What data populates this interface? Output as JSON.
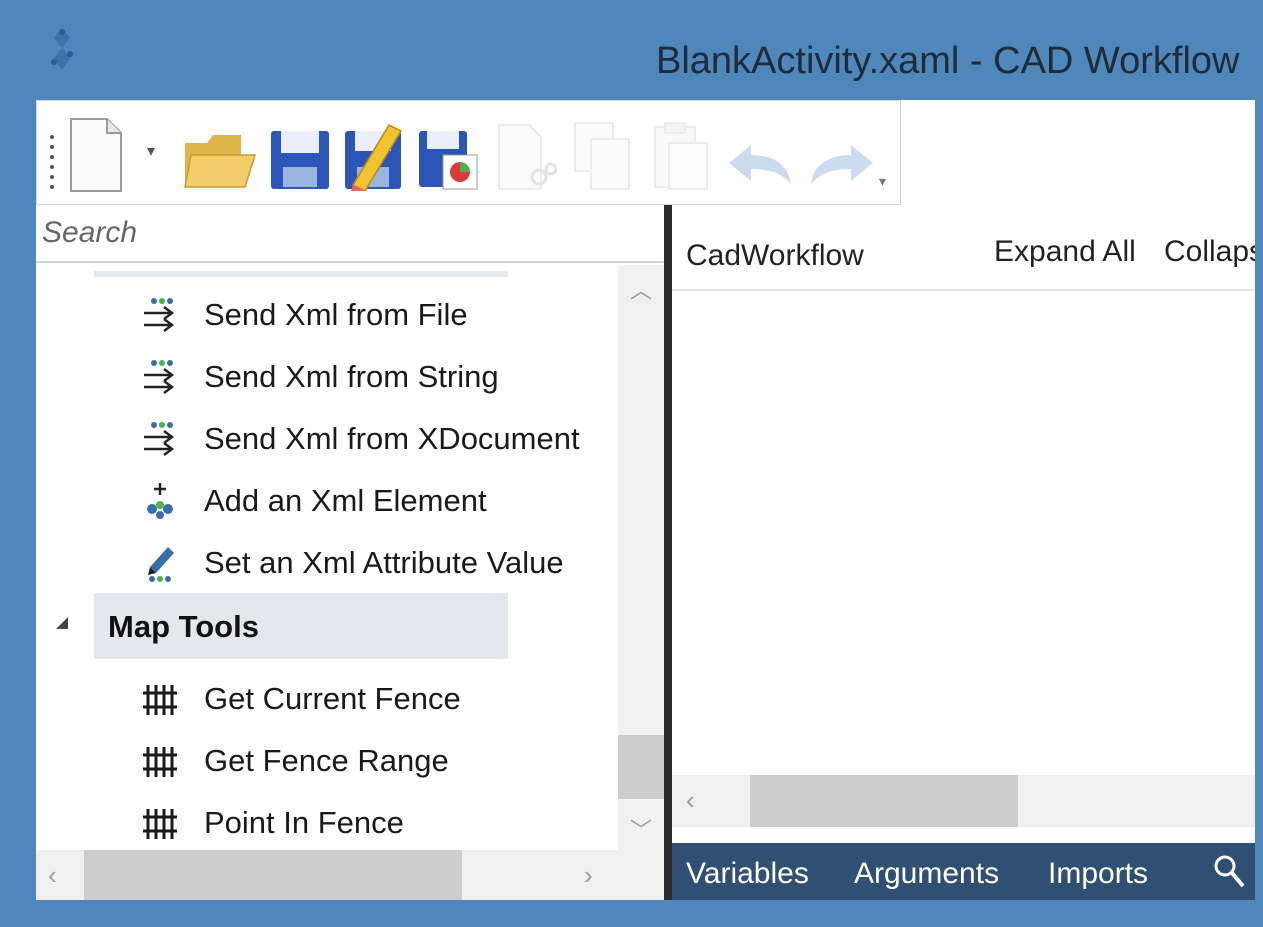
{
  "window": {
    "title": "BlankActivity.xaml - CAD Workflow",
    "app_icon": "app-logo-icon"
  },
  "toolbar": {
    "buttons": [
      {
        "name": "new-document",
        "icon": "new-document-icon",
        "enabled": true
      },
      {
        "name": "open-folder",
        "icon": "folder-icon",
        "enabled": true
      },
      {
        "name": "save",
        "icon": "save-icon",
        "enabled": true
      },
      {
        "name": "save-as",
        "icon": "save-as-icon",
        "enabled": true
      },
      {
        "name": "save-all",
        "icon": "save-all-icon",
        "enabled": true
      },
      {
        "name": "cut",
        "icon": "cut-icon",
        "enabled": false
      },
      {
        "name": "copy",
        "icon": "copy-icon",
        "enabled": false
      },
      {
        "name": "paste",
        "icon": "paste-icon",
        "enabled": false
      },
      {
        "name": "undo",
        "icon": "undo-icon",
        "enabled": false
      },
      {
        "name": "redo",
        "icon": "redo-icon",
        "enabled": false
      }
    ]
  },
  "toolbox": {
    "search_placeholder": "Search",
    "items": [
      {
        "label": "Send Xml from File",
        "icon": "send-xml-icon"
      },
      {
        "label": "Send Xml from String",
        "icon": "send-xml-icon"
      },
      {
        "label": "Send Xml from XDocument",
        "icon": "send-xml-icon"
      },
      {
        "label": "Add an Xml Element",
        "icon": "add-xml-element-icon"
      },
      {
        "label": "Set an Xml Attribute Value",
        "icon": "set-xml-attribute-icon"
      }
    ],
    "category": {
      "label": "Map Tools",
      "expanded": true
    },
    "category_items": [
      {
        "label": "Get Current Fence",
        "icon": "fence-icon"
      },
      {
        "label": "Get Fence Range",
        "icon": "fence-icon"
      },
      {
        "label": "Point In Fence",
        "icon": "fence-icon"
      }
    ]
  },
  "designer": {
    "breadcrumb": "CadWorkflow",
    "expand_all": "Expand All",
    "collapse_all": "Collaps",
    "bottom_tabs": [
      "Variables",
      "Arguments",
      "Imports"
    ]
  },
  "colors": {
    "title_bar": "#4f87bb",
    "bottom_bar": "#2f4f73",
    "category_highlight": "#e4e7eb",
    "scroll_track": "#f0f0f0",
    "scroll_thumb": "#cdcdcd"
  }
}
